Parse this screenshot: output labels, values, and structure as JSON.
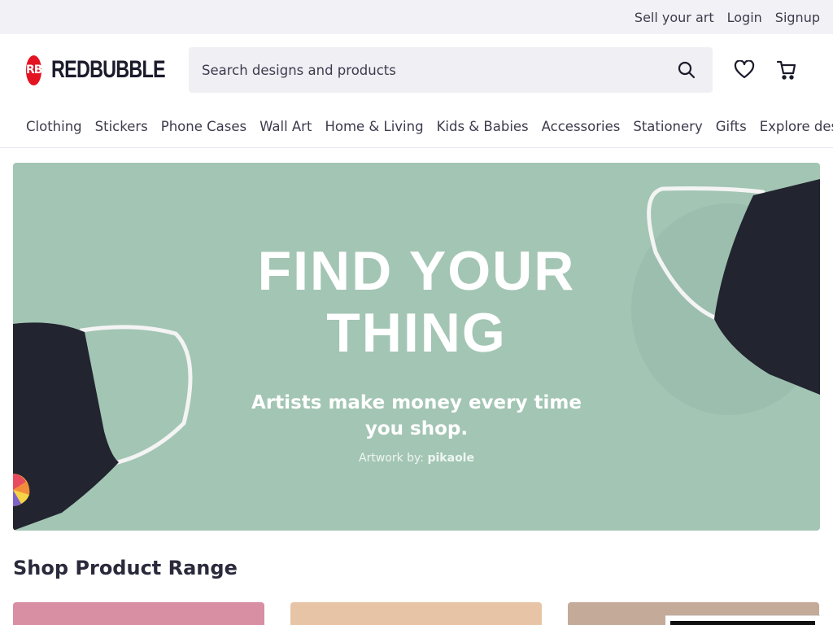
{
  "topbar": {
    "sell_label": "Sell your art",
    "login_label": "Login",
    "signup_label": "Signup"
  },
  "header": {
    "logo_mark": "RB",
    "logo_text": "REDBUBBLE",
    "search_placeholder": "Search designs and products",
    "icons": [
      "search-icon",
      "heart-icon",
      "cart-icon"
    ]
  },
  "nav": {
    "items": [
      "Clothing",
      "Stickers",
      "Phone Cases",
      "Wall Art",
      "Home & Living",
      "Kids & Babies",
      "Accessories",
      "Stationery",
      "Gifts",
      "Explore designs"
    ]
  },
  "hero": {
    "title_line1": "FIND YOUR",
    "title_line2": "THING",
    "subtitle": "Artists make money every time you shop.",
    "credit_prefix": "Artwork by:",
    "credit_artist": "pikaole",
    "background": "#a3c5b4"
  },
  "section": {
    "title": "Shop Product Range"
  },
  "colors": {
    "brand_red": "#e41321",
    "card1": "#d88ea3",
    "card2": "#e8c4a7",
    "card3": "#c4aa99"
  }
}
